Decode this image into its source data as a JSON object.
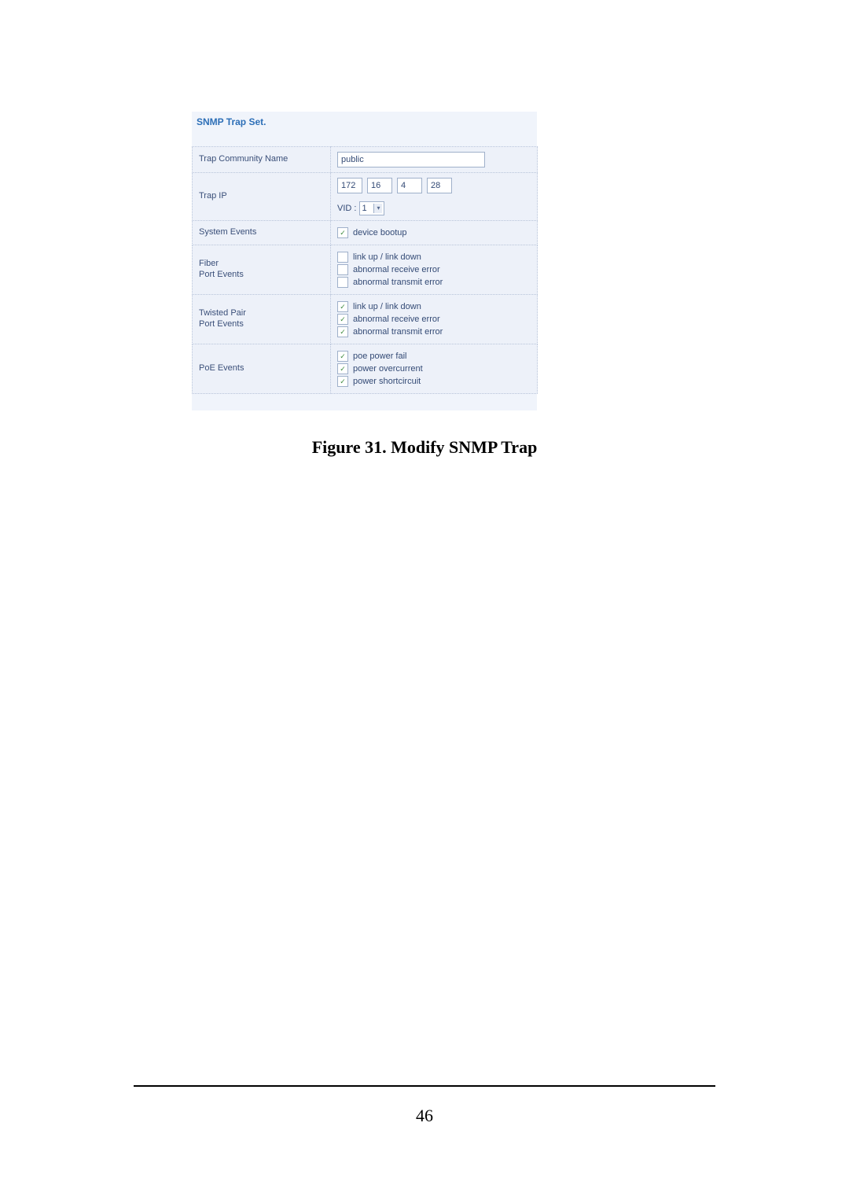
{
  "shot": {
    "title": "SNMP Trap Set.",
    "rows": {
      "community": {
        "label": "Trap Community Name",
        "value": "public"
      },
      "trap_ip": {
        "label": "Trap IP",
        "octets": [
          "172",
          "16",
          "4",
          "28"
        ],
        "ver_label": "VID :",
        "ver_value": "1"
      },
      "system_events": {
        "label": "System Events",
        "items": [
          {
            "label": "device bootup",
            "checked": true
          }
        ]
      },
      "fiber_port_events": {
        "label_line1": "Fiber",
        "label_line2": "Port Events",
        "items": [
          {
            "label": "link up / link down",
            "checked": false
          },
          {
            "label": "abnormal receive error",
            "checked": false
          },
          {
            "label": "abnormal transmit error",
            "checked": false
          }
        ]
      },
      "twisted_pair_events": {
        "label_line1": "Twisted Pair",
        "label_line2": "Port Events",
        "items": [
          {
            "label": "link up / link down",
            "checked": true
          },
          {
            "label": "abnormal receive error",
            "checked": true
          },
          {
            "label": "abnormal transmit error",
            "checked": true
          }
        ]
      },
      "poe_events": {
        "label": "PoE Events",
        "items": [
          {
            "label": "poe power fail",
            "checked": true
          },
          {
            "label": "power overcurrent",
            "checked": true
          },
          {
            "label": "power shortcircuit",
            "checked": true
          }
        ]
      }
    }
  },
  "caption": "Figure 31.  Modify SNMP Trap",
  "page_number": "46"
}
